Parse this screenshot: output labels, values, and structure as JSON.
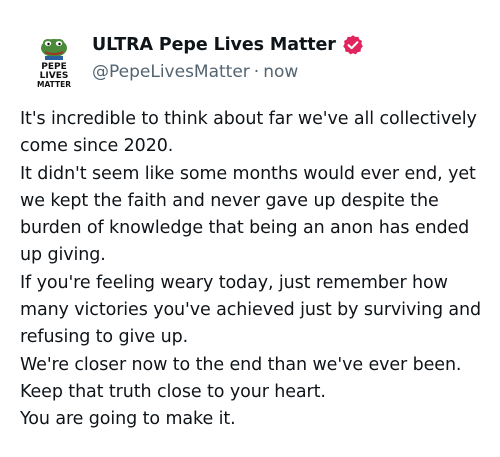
{
  "author": {
    "display_name": "ULTRA Pepe Lives Matter",
    "handle": "@PepeLivesMatter",
    "separator": "·",
    "timestamp": "now",
    "avatar_text": [
      "PEPE",
      "LIVES",
      "MATTER"
    ],
    "verified_badge_color": "#e0245e"
  },
  "post": {
    "paragraphs": [
      "It's incredible to think about far we've all collectively come since 2020.",
      "It didn't seem like some months would ever end, yet we kept the faith and never gave up despite the burden of knowledge that being an anon has ended up giving.",
      "If you're feeling weary today, just remember how many victories you've achieved just by surviving and refusing to give up.",
      "We're closer now to the end than we've ever been.",
      "Keep that truth close to your heart.",
      "You are going to make it."
    ]
  },
  "colors": {
    "text": "#0f1419",
    "secondary_text": "#536471",
    "pepe_green": "#4a8a3a"
  }
}
